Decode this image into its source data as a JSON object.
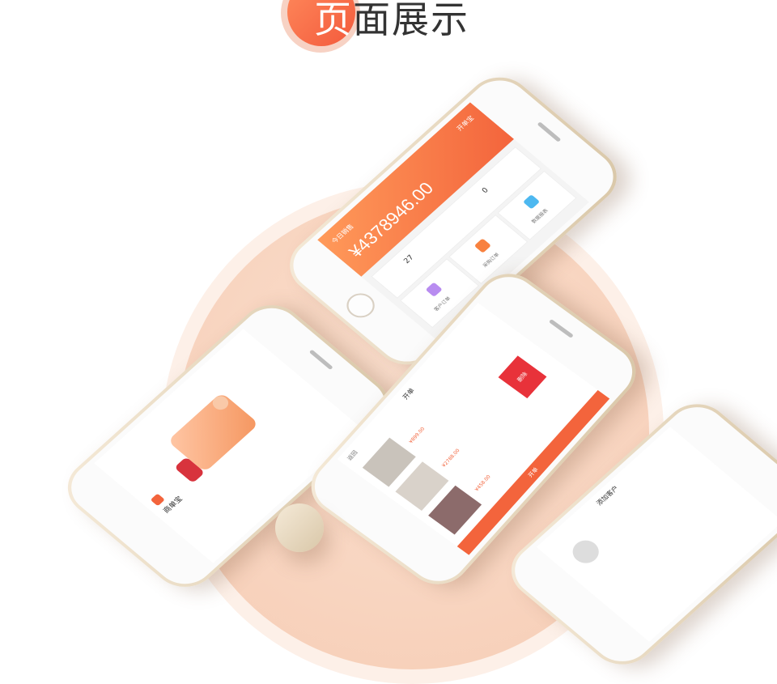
{
  "page": {
    "title_first_char": "页",
    "title_rest": "面展示"
  },
  "colors": {
    "accent": "#f3643c",
    "accent_light": "#ff9a5a",
    "bg_circle": "#f8d4bf",
    "title_text": "#333333",
    "red_button": "#e8323a"
  },
  "phone_dashboard": {
    "header_title": "今日销售",
    "header_right": "开单宝",
    "amount": "¥4378946.00",
    "stat_left_value": "27",
    "stat_right_value": "0",
    "tiles": [
      "客户订单",
      "采购订单",
      "数据报表"
    ]
  },
  "phone_splash": {
    "brand": "商单宝"
  },
  "phone_order": {
    "nav_title": "开单",
    "nav_left": "返回",
    "items": [
      {
        "price": "¥899.00"
      },
      {
        "price": "¥2788.00"
      },
      {
        "price": "¥458.00"
      }
    ],
    "delete_label": "删除",
    "submit_label": "开单"
  },
  "phone_addcustomer": {
    "nav_title": "添加客户"
  }
}
